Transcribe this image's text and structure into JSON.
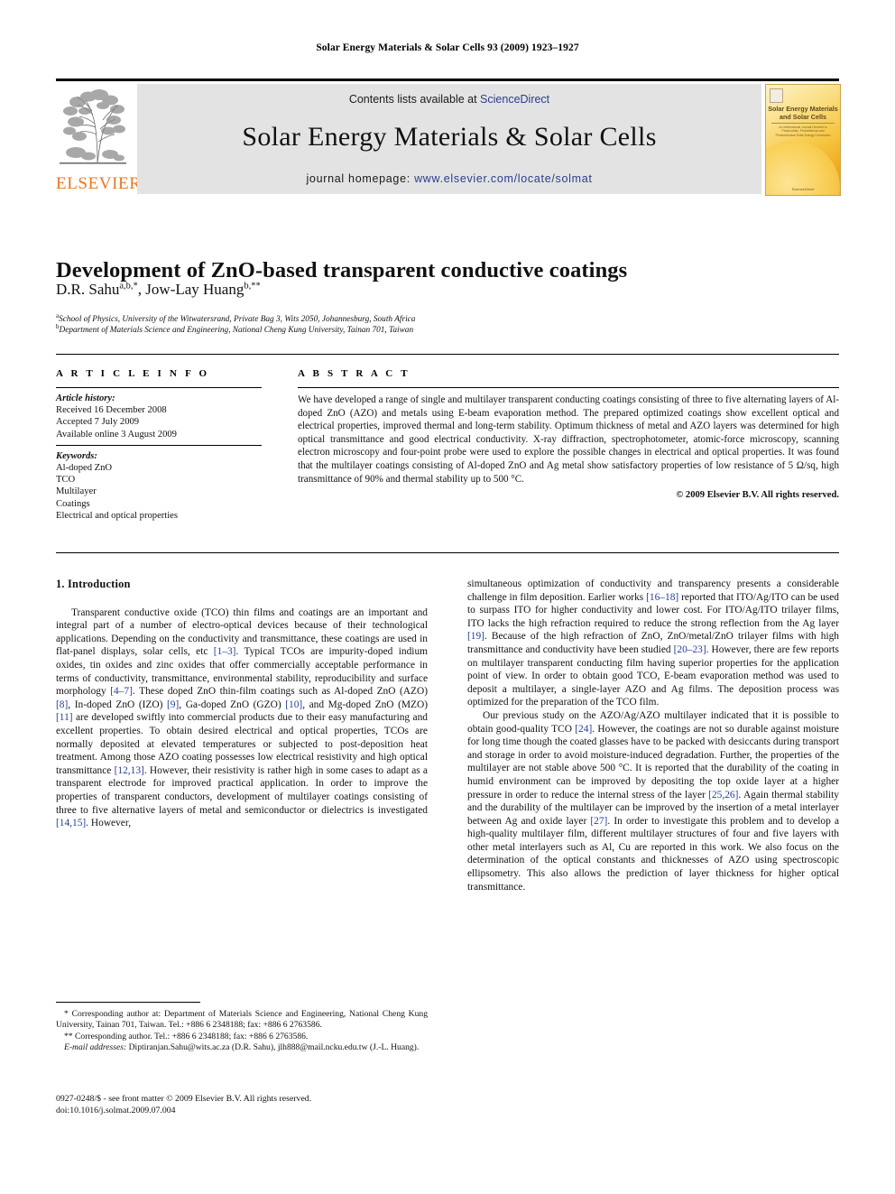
{
  "running_head": "Solar Energy Materials & Solar Cells 93 (2009) 1923–1927",
  "masthead": {
    "publisher_wordmark": "ELSEVIER",
    "contents_prefix": "Contents lists available at ",
    "contents_link": "ScienceDirect",
    "journal_title": "Solar Energy Materials & Solar Cells",
    "homepage_prefix": "journal homepage: ",
    "homepage_link": "www.elsevier.com/locate/solmat",
    "cover": {
      "title_line1": "Solar Energy Materials",
      "title_line2": "and Solar Cells",
      "subtitle": "An International Journal Devoted to Photovoltaic, Photothermal and Photochemical Solar Energy Conversion",
      "footer": "ScienceDirect"
    },
    "link_color": "#2b3c8f",
    "wordmark_color": "#e87722",
    "band_color": "#e3e3e3"
  },
  "article": {
    "title": "Development of ZnO-based transparent conductive coatings",
    "authors_plain": "D.R. Sahu a,b,*, Jow-Lay Huang b,**",
    "author1_name": "D.R. Sahu",
    "author1_marks": "a,b,*",
    "author2_name": ", Jow-Lay Huang",
    "author2_marks": "b,**",
    "affiliation_a_mark": "a",
    "affiliation_a": "School of Physics, University of the Witwatersrand, Private Bag 3, Wits 2050, Johannesburg, South Africa",
    "affiliation_b_mark": "b",
    "affiliation_b": "Department of Materials Science and Engineering, National Cheng Kung University, Tainan 701, Taiwan"
  },
  "article_info": {
    "heading": "A R T I C L E  I N F O",
    "history_label": "Article history:",
    "history": [
      "Received 16 December 2008",
      "Accepted 7 July 2009",
      "Available online 3 August 2009"
    ],
    "keywords_label": "Keywords:",
    "keywords": [
      "Al-doped ZnO",
      "TCO",
      "Multilayer",
      "Coatings",
      "Electrical and optical properties"
    ]
  },
  "abstract": {
    "heading": "A B S T R A C T",
    "text": "We have developed a range of single and multilayer transparent conducting coatings consisting of three to five alternating layers of Al-doped ZnO (AZO) and metals using E-beam evaporation method. The prepared optimized coatings show excellent optical and electrical properties, improved thermal and long-term stability. Optimum thickness of metal and AZO layers was determined for high optical transmittance and good electrical conductivity. X-ray diffraction, spectrophotometer, atomic-force microscopy, scanning electron microscopy and four-point probe were used to explore the possible changes in electrical and optical properties. It was found that the multilayer coatings consisting of Al-doped ZnO and Ag metal show satisfactory properties of low resistance of 5 Ω/sq, high transmittance of 90% and thermal stability up to 500 °C.",
    "copyright": "© 2009 Elsevier B.V. All rights reserved."
  },
  "body": {
    "section1_heading": "1.  Introduction",
    "left_p1_a": "Transparent conductive oxide (TCO) thin films and coatings are an important and integral part of a number of electro-optical devices because of their technological applications. Depending on the conductivity and transmittance, these coatings are used in flat-panel displays, solar cells, etc ",
    "left_ref_1_3": "[1–3]",
    "left_p1_b": ". Typical TCOs are impurity-doped indium oxides, tin oxides and zinc oxides that offer commercially acceptable performance in terms of conductivity, transmittance, environmental stability, reproducibility and surface morphology ",
    "left_ref_4_7": "[4–7]",
    "left_p1_c": ". These doped ZnO thin-film coatings such as Al-doped ZnO (AZO) ",
    "left_ref_8": "[8]",
    "left_p1_d": ", In-doped ZnO (IZO) ",
    "left_ref_9": "[9]",
    "left_p1_e": ", Ga-doped ZnO (GZO) ",
    "left_ref_10": "[10]",
    "left_p1_f": ", and Mg-doped ZnO (MZO) ",
    "left_ref_11": "[11]",
    "left_p1_g": " are developed swiftly into commercial products due to their easy manufacturing and excellent properties. To obtain desired electrical and optical properties, TCOs are normally deposited at elevated temperatures or subjected to post-deposition heat treatment. Among those AZO coating possesses low electrical resistivity and high optical transmittance ",
    "left_ref_12_13": "[12,13]",
    "left_p1_h": ". However, their resistivity is rather high in some cases to adapt as a transparent electrode for improved practical application. In order to improve the properties of transparent conductors, development of multilayer coatings consisting of three to five alternative layers of metal and semiconductor or dielectrics is investigated ",
    "left_ref_14_15": "[14,15]",
    "left_p1_i": ". However,",
    "right_p1_a": "simultaneous optimization of conductivity and transparency presents a considerable challenge in film deposition. Earlier works ",
    "right_ref_16_18": "[16–18]",
    "right_p1_b": " reported that ITO/Ag/ITO can be used to surpass ITO for higher conductivity and lower cost. For ITO/Ag/ITO trilayer films, ITO lacks the high refraction required to reduce the strong reflection from the Ag layer ",
    "right_ref_19": "[19]",
    "right_p1_c": ". Because of the high refraction of ZnO, ZnO/metal/ZnO trilayer films with high transmittance and conductivity have been studied ",
    "right_ref_20_23": "[20–23]",
    "right_p1_d": ". However, there are few reports on multilayer transparent conducting film having superior properties for the application point of view. In order to obtain good TCO, E-beam evaporation method was used to deposit a multilayer, a single-layer AZO and Ag films. The deposition process was optimized for the preparation of the TCO film.",
    "right_p2_a": "Our previous study on the AZO/Ag/AZO multilayer indicated that it is possible to obtain good-quality TCO ",
    "right_ref_24": "[24]",
    "right_p2_b": ". However, the coatings are not so durable against moisture for long time though the coated glasses have to be packed with desiccants during transport and storage in order to avoid moisture-induced degradation. Further, the properties of the multilayer are not stable above 500 °C. It is reported that the durability of the coating in humid environment can be improved by depositing the top oxide layer at a higher pressure in order to reduce the internal stress of the layer ",
    "right_ref_25_26": "[25,26]",
    "right_p2_c": ". Again thermal stability and the durability of the multilayer can be improved by the insertion of a metal interlayer between Ag and oxide layer ",
    "right_ref_27": "[27]",
    "right_p2_d": ". In order to investigate this problem and to develop a high-quality multilayer film, different multilayer structures of four and five layers with other metal interlayers such as Al, Cu are reported in this work. We also focus on the determination of the optical constants and thicknesses of AZO using spectroscopic ellipsometry. This also allows the prediction of layer thickness for higher optical transmittance."
  },
  "footnotes": {
    "corr1_mark": "*",
    "corr1": " Corresponding author at: Department of Materials Science and Engineering, National Cheng Kung University, Tainan 701, Taiwan. Tel.: +886 6 2348188; fax: +886 6 2763586.",
    "corr2_mark": "**",
    "corr2": " Corresponding author. Tel.: +886 6 2348188; fax: +886 6 2763586.",
    "email_label": "E-mail addresses:",
    "emails": " Diptiranjan.Sahu@wits.ac.za (D.R. Sahu), jlh888@mail.ncku.edu.tw (J.-L. Huang)."
  },
  "imprint": {
    "line1": "0927-0248/$ - see front matter © 2009 Elsevier B.V. All rights reserved.",
    "line2": "doi:10.1016/j.solmat.2009.07.004"
  }
}
